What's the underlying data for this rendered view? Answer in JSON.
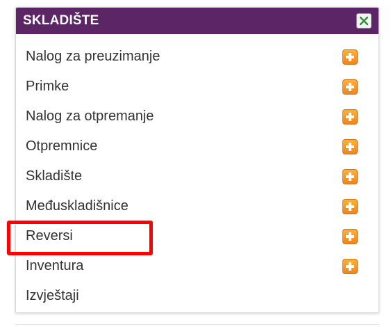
{
  "panel": {
    "title": "SKLADIŠTE",
    "close_icon": "close-x-icon",
    "header_color": "#5c2566"
  },
  "menu": {
    "items": [
      {
        "label": "Nalog za preuzimanje",
        "has_add": true
      },
      {
        "label": "Primke",
        "has_add": true
      },
      {
        "label": "Nalog za otpremanje",
        "has_add": true
      },
      {
        "label": "Otpremnice",
        "has_add": true
      },
      {
        "label": "Skladište",
        "has_add": true
      },
      {
        "label": "Međuskladišnice",
        "has_add": true
      },
      {
        "label": "Reversi",
        "has_add": true
      },
      {
        "label": "Inventura",
        "has_add": true
      },
      {
        "label": "Izvještaji",
        "has_add": false
      }
    ],
    "add_icon": "plus-icon",
    "add_icon_color": "#f39c1f"
  },
  "annotation": {
    "highlighted_item": "Reversi",
    "color": "#ff0000"
  }
}
